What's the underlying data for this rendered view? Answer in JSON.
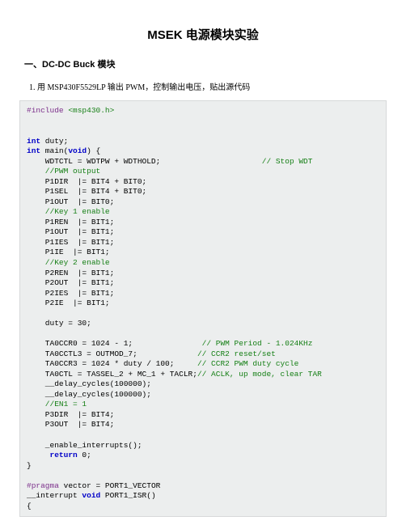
{
  "title": "MSEK 电源模块实验",
  "section": "一、DC-DC Buck 模块",
  "instruction": "1. 用 MSP430F5529LP 输出 PWM，控制输出电压，贴出源代码",
  "code": {
    "include": "#include",
    "header": "<msp430.h>",
    "int_kw": "int",
    "duty_decl": " duty;",
    "main_sig1": " main(",
    "void_kw": "void",
    "main_sig2": ") {",
    "l1a": "    WDTCTL = WDTPW + WDTHOLD;                      ",
    "l1c": "// Stop WDT",
    "l2": "    //PWM output",
    "l3": "    P1DIR  |= BIT4 + BIT0;",
    "l4": "    P1SEL  |= BIT4 + BIT0;",
    "l5": "    P1OUT  |= BIT0;",
    "l6": "    //Key 1 enable",
    "l7": "    P1REN  |= BIT1;",
    "l8": "    P1OUT  |= BIT1;",
    "l9": "    P1IES  |= BIT1;",
    "l10": "    P1IE  |= BIT1;",
    "l11": "    //Key 2 enable",
    "l12": "    P2REN  |= BIT1;",
    "l13": "    P2OUT  |= BIT1;",
    "l14": "    P2IES  |= BIT1;",
    "l15": "    P2IE  |= BIT1;",
    "blank1": "",
    "l16": "    duty = 30;",
    "blank2": "",
    "l17a": "    TA0CCR0 = 1024 - 1;               ",
    "l17c": "// PWM Period - 1.024KHz",
    "l18a": "    TA0CCTL3 = OUTMOD_7;             ",
    "l18c": "// CCR2 reset/set",
    "l19a": "    TA0CCR3 = 1024 * duty / 100;     ",
    "l19c": "// CCR2 PWM duty cycle",
    "l20a": "    TA0CTL = TASSEL_2 + MC_1 + TACLR;",
    "l20c": "// ACLK, up mode, clear TAR",
    "l21": "    __delay_cycles(100000);",
    "l22": "    __delay_cycles(100000);",
    "l23": "    //EN1 = 1",
    "l24": "    P3DIR  |= BIT4;",
    "l25": "    P3OUT  |= BIT4;",
    "blank3": "",
    "l26": "    _enable_interrupts();",
    "ret_pad": "     ",
    "ret_kw": "return",
    "ret_val": " 0;",
    "l28": "}",
    "blank4": "",
    "prag_kw": "#pragma",
    "prag_rest": " vector = PORT1_VECTOR",
    "isr1": "__interrupt ",
    "isr2": " PORT1_ISR()",
    "l31": "{"
  }
}
